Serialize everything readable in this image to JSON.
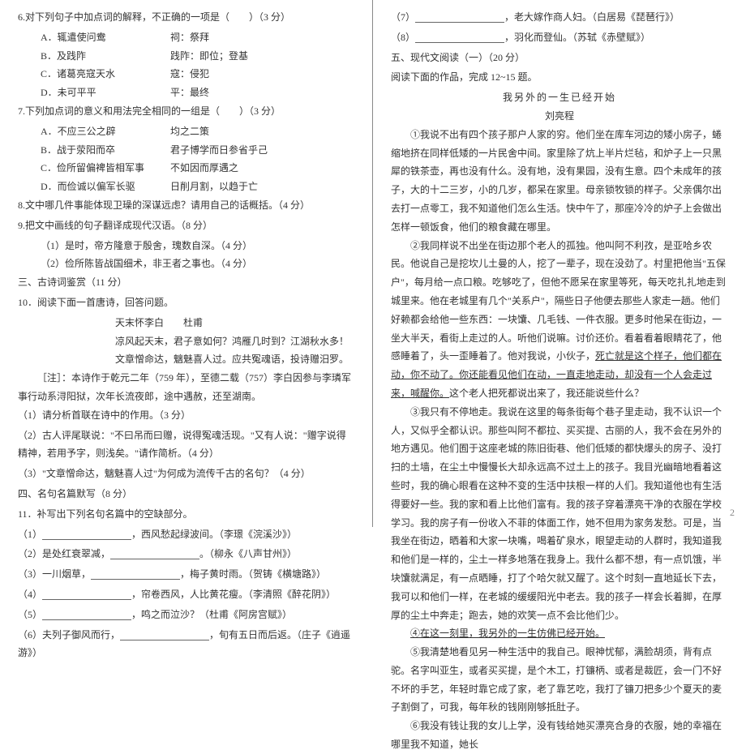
{
  "left": {
    "q6": {
      "stem": "6.对下列句子中加点词的解释，不正确的一项是（　　）（3 分）",
      "A": [
        "A．辄遣使问鸯",
        "祠：祭拜"
      ],
      "B": [
        "B．及践阼",
        "践阼：即位；登基"
      ],
      "C": [
        "C．诸葛亮寇天水",
        "寇：侵犯"
      ],
      "D": [
        "D．未可平平",
        "平：最终"
      ]
    },
    "q7": {
      "stem": "7.下列加点词的意义和用法完全相同的一组是（　　）（3 分）",
      "A": [
        "A．不应三公之辟",
        "均之二策"
      ],
      "B": [
        "B．战于荥阳而卒",
        "君子博学而日参省乎己"
      ],
      "C": [
        "C．俭所留偏裨皆相军事",
        "不如因而厚遇之"
      ],
      "D": [
        "D．而俭诚以偏军长驱",
        "日削月割，以趋于亡"
      ]
    },
    "q8": "8.文中哪几件事能体现卫璪的深谋远虑？请用自己的话概括。（4 分）",
    "q9": {
      "stem": "9.把文中画线的句子翻译成现代汉语。（8 分）",
      "s1": "（1）是时，帝方隆意于殷舍，瑰数自深。（4 分）",
      "s2": "（2）俭所陈皆战国细术，非王者之事也。（4 分）"
    },
    "section3": "三、古诗词鉴赏（11 分）",
    "q10": {
      "stem": "10．阅读下面一首唐诗，回答问题。",
      "title": "天末怀李白　　杜甫",
      "l1": "凉风起天末，君子意如何？鸿雁几时到？江湖秋水多！",
      "l2": "文章憎命达，魑魅喜人过。应共冤魂语，投诗赠汨罗。",
      "note": "［注］：本诗作于乾元二年（759 年），至德二载（757）李白因参与李璘军事行动系浔阳狱，次年长流夜郎，途中遇赦，还至湖南。",
      "s1": "（1）请分析首联在诗中的作用。（3 分）",
      "s2": "（2）古人评尾联说：\"不曰吊而曰赠，说得冤魂活现。\"又有人说：\"赠字说得精神，若用予字，则浅矣。\"请作简析。（4 分）",
      "s3": "（3）\"文章憎命达，魑魅喜人过\"为何成为流传千古的名句？（4 分）"
    },
    "section4": "四、名句名篇默写（8 分）",
    "q11": {
      "stem": "11．补写出下列名句名篇中的空缺部分。",
      "rows": [
        [
          "（1）",
          "，西风愁起绿波间。（李璟《浣溪沙》）"
        ],
        [
          "（2）是处红衰翠减，",
          "。（柳永《八声甘州》）"
        ],
        [
          "（3）一川烟草，",
          "，梅子黄时雨。（贺铸《横塘路》）"
        ],
        [
          "（4）",
          "，帘卷西风，人比黄花瘦。（李清照《醉花阴》）"
        ],
        [
          "（5）",
          "，鸣之而泣沙？（杜甫《阿房宫赋》）"
        ],
        [
          "（6）夫列子御风而行，",
          "，旬有五日而后返。（庄子《逍遥游》）"
        ]
      ]
    }
  },
  "right": {
    "rows": [
      [
        "（7）",
        "，老大嫁作商人妇。（白居易《琵琶行》）"
      ],
      [
        "（8）",
        "，羽化而登仙。（苏轼《赤壁赋》）"
      ]
    ],
    "section5": "五、现代文阅读（一）（20 分）",
    "prompt": "阅读下面的作品，完成 12~15 题。",
    "title": "我另外的一生已经开始",
    "author": "刘亮程",
    "para1": "①我说不出有四个孩子那户人家的穷。他们坐在库车河边的矮小房子，蜷缩地挤在同样低矮的一片民舍中间。家里除了炕上半片烂毡，和炉子上一只黑犀的铁茶壶，再也没有什么。没有地，没有果园，没有生意。四个未成年的孩子，大的十二三岁，小的几岁，都呆在家里。母亲锁牧锁的样子。父亲偶尔出去打一点零工，我不知道他们怎么生活。快中午了，那座冷冷的炉子上会做出怎样一顿饭食，他们的粮食藏在哪里。",
    "para2": "②我同样说不出坐在街边那个老人的孤独。他叫阿不利孜，是亚哈乡农民。他说自己是挖坎儿土曼的人，挖了一辈子，现在没劲了。村里把他当\"五保户\"，每月给一点口粮。吃够吃了，但他不愿呆在家里等死，每天吃扎扎地走到城里来。他在老城里有几个\"关系户\"，隔些日子他便去那些人家走一趟。他们好赖都会给他一些东西：一块馕、几毛钱、一件衣服。更多时他呆在街边，一坐大半天，看街上走过的人。听他们说嘛。讨价还价。看着看着眼睛花了，他感睡着了，头一歪睡着了。他对我说，小伙子，",
    "para2u": "死亡就是这个样子，他们都在动，你不动了。你还能看见他们在动，一直走地走动，却没有一个人会走过来，喊醒你。",
    "para2b": "这个老人把死都说出来了，我还能说些什么？",
    "para3": "③我只有不停地走。我说在这里的每条街每个巷子里走动，我不认识一个人，又似乎全都认识。那些叫阿不都拉、买买提、古丽的人，我不会在另外的地方遇见。他们囿于这座老城的陈旧街巷、他们低矮的都快爆头的房子、没打扫的土墙，在尘土中慢慢长大却永远高不过土上的孩子。我目光幽暗地看着这些时，我的确心眼看在这种不变的生活中扶根一样的人们。我知道他也有生活得要好一些。我的家和看上比他们富有。我的孩子穿着漂亮干净的衣服在学校学习。我的房子有一份收入不菲的体面工作，她不但用为家务发愁。可是，当我坐在街边，晒着和大家一块嘴，喝着矿泉水，眼望走动的人群时，我知道我和他们是一样的，尘土一样多地落在我身上。我什么都不想，有一点饥饿，半块馕就满足，有一点晒睡，打了个哈欠就又醒了。这个时刻一直地延长下去，我可以和他们一样，在老城的缓缓阳光中老去。我的孩子一样会长着脚，在厚厚的尘土中奔走；跑去，她的欢笑一点不会比他们少。",
    "para4u": "④在这一刻里，我另外的一生仿佛已经开始。",
    "para5": "⑤我清楚地看见另一种生活中的我自己。眼神忧郁，满脸胡须，背有点驼。名字叫亚生，或者买买提，是个木工，打镰柄、或者是裁匠，会一门不好不坏的手艺，年轻时靠它成了家，老了靠艺吃，我打了镰刀把多少个夏天的麦子割倒了，可我，每年秋的钱刚刚够抵肚子。",
    "para6": "⑥我没有钱让我的女儿上学，没有钱给她买漂亮合身的衣服，她的幸福在哪里我不知道，她长"
  },
  "pagenum": "2"
}
